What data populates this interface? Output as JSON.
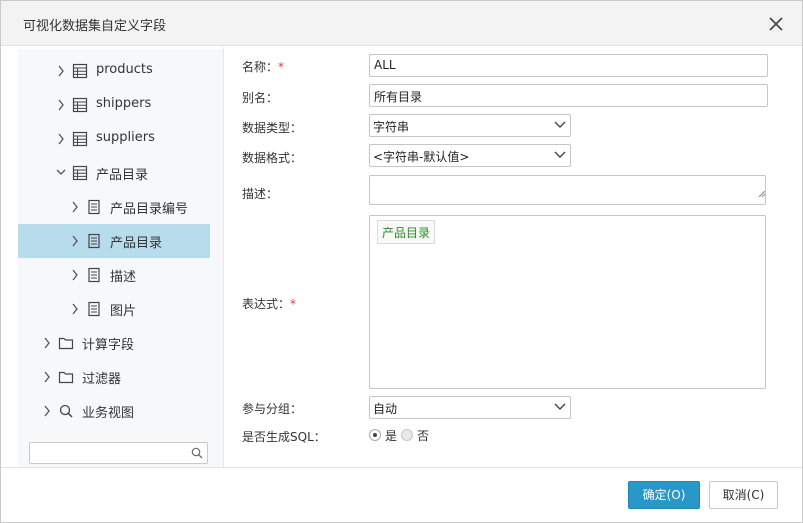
{
  "window": {
    "title": "可视化数据集自定义字段"
  },
  "tree": {
    "items": [
      {
        "label": "products",
        "icon": "table-icon"
      },
      {
        "label": "shippers",
        "icon": "table-icon"
      },
      {
        "label": "suppliers",
        "icon": "table-icon"
      },
      {
        "label": "产品目录",
        "icon": "table-icon",
        "expanded": true
      },
      {
        "label": "产品目录编号",
        "icon": "field-icon"
      },
      {
        "label": "产品目录",
        "icon": "field-icon",
        "selected": true
      },
      {
        "label": "描述",
        "icon": "field-icon"
      },
      {
        "label": "图片",
        "icon": "field-icon"
      },
      {
        "label": "计算字段",
        "icon": "folder-icon"
      },
      {
        "label": "过滤器",
        "icon": "folder-icon"
      },
      {
        "label": "业务视图",
        "icon": "search-icon"
      }
    ],
    "search_value": ""
  },
  "form": {
    "name_label": "名称：",
    "name_required": "*",
    "name_value": "ALL",
    "alias_label": "别名：",
    "alias_value": "所有目录",
    "datatype_label": "数据类型：",
    "datatype_value": "字符串",
    "dataformat_label": "数据格式：",
    "dataformat_value": "<字符串-默认值>",
    "desc_label": "描述：",
    "desc_value": "",
    "expr_label": "表达式：",
    "expr_required": "*",
    "expr_tag": "产品目录",
    "group_label": "参与分组：",
    "group_value": "自动",
    "sql_label": "是否生成SQL：",
    "sql_yes": "是",
    "sql_no": "否",
    "sql_selected": "是"
  },
  "footer": {
    "ok_label": "确定(O)",
    "cancel_label": "取消(C)"
  },
  "colors": {
    "accent": "#2a97c9",
    "selected_row": "#b7dcec",
    "required": "#e03c3c",
    "tag_text": "#2c8c2c"
  }
}
